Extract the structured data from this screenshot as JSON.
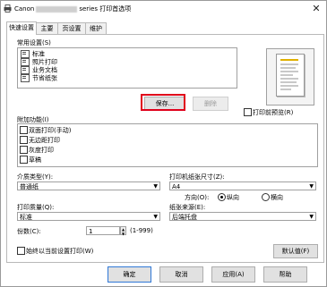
{
  "window": {
    "title_prefix": "Canon",
    "title_suffix": "series 打印首选项",
    "close": "✕"
  },
  "tabs": [
    {
      "label": "快速设置"
    },
    {
      "label": "主要"
    },
    {
      "label": "页设置"
    },
    {
      "label": "维护"
    }
  ],
  "common_settings": {
    "label": "常用设置(S)",
    "items": [
      "标准",
      "照片打印",
      "业务文档",
      "节省纸张"
    ]
  },
  "save_button": "保存...",
  "delete_button": "删除",
  "preview_checkbox_label": "打印前预览(R)",
  "additional": {
    "label": "附加功能(I)",
    "items": [
      "双面打印(手动)",
      "无边距打印",
      "灰度打印",
      "草稿"
    ]
  },
  "media_type": {
    "label": "介质类型(Y):",
    "value": "普通纸"
  },
  "paper_size": {
    "label": "打印机纸张尺寸(Z):",
    "value": "A4"
  },
  "orientation": {
    "label": "方向(O):",
    "portrait": "纵向",
    "landscape": "横向",
    "selected": "portrait"
  },
  "print_quality": {
    "label": "打印质量(Q):",
    "value": "标准"
  },
  "paper_source": {
    "label": "纸张来源(E):",
    "value": "后端托盘"
  },
  "copies": {
    "label": "份数(C):",
    "value": "1",
    "range": "(1-999)"
  },
  "always_print_label": "始终以当前设置打印(W)",
  "defaults_button": "默认值(F)",
  "footer": {
    "ok": "确定",
    "cancel": "取消",
    "apply": "应用(A)",
    "help": "帮助"
  }
}
